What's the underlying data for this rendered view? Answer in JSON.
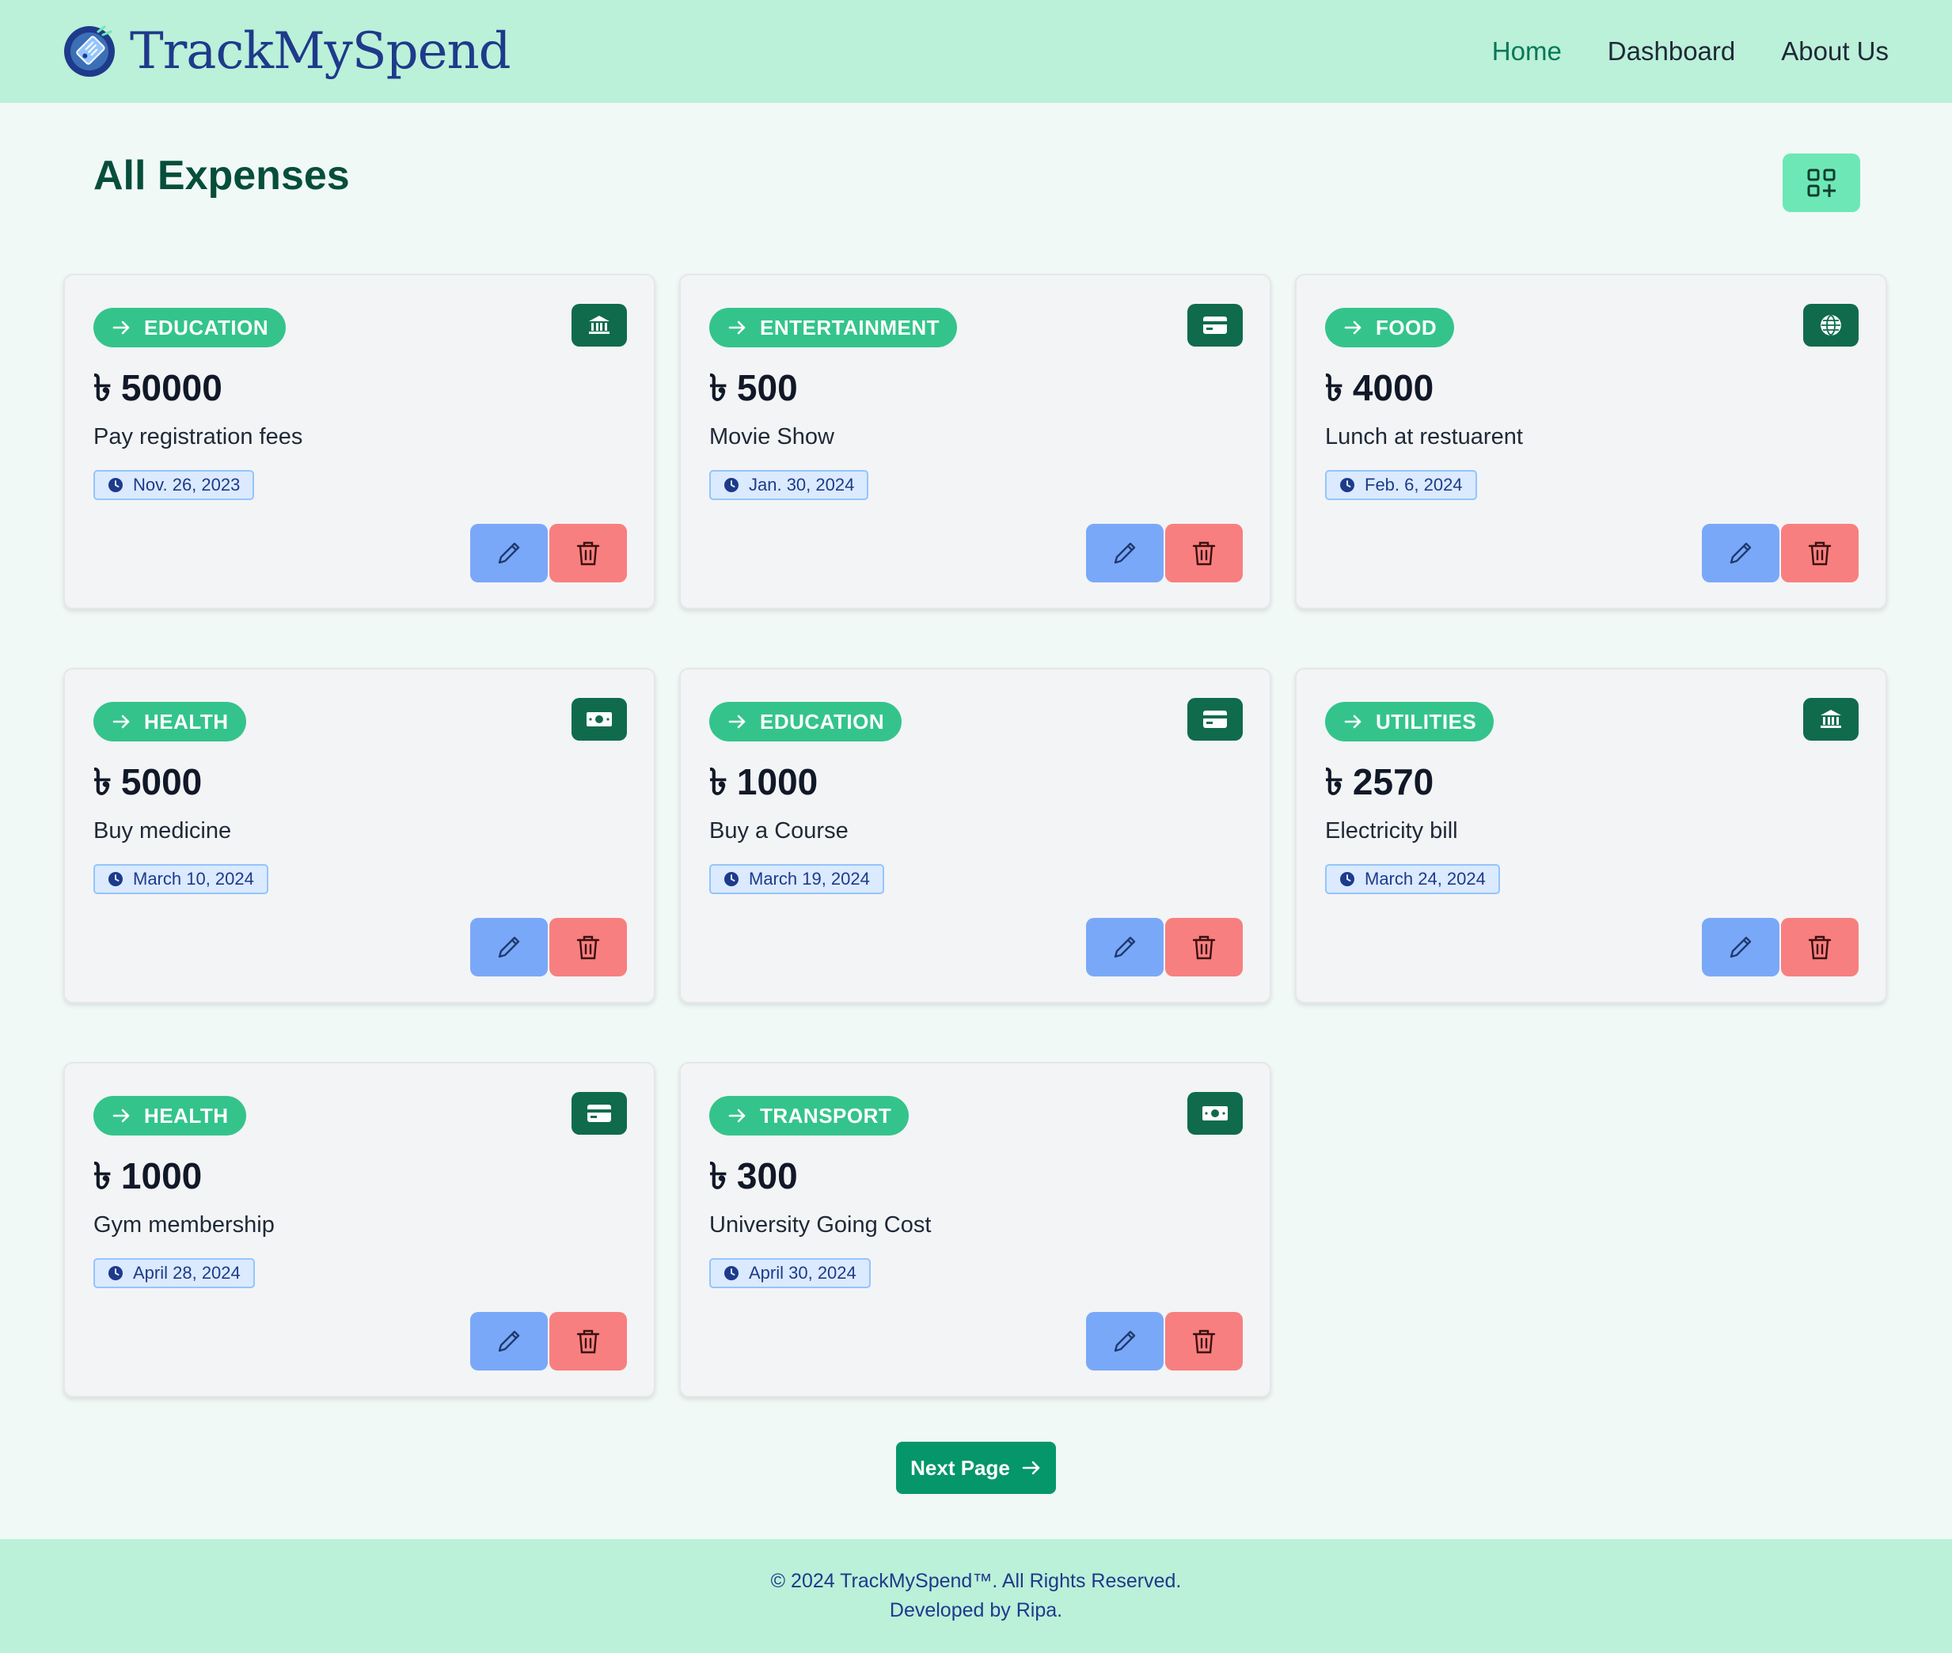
{
  "brand": {
    "name": "TrackMySpend"
  },
  "nav": {
    "items": [
      {
        "label": "Home",
        "active": true
      },
      {
        "label": "Dashboard",
        "active": false
      },
      {
        "label": "About Us",
        "active": false
      }
    ]
  },
  "page": {
    "title": "All Expenses"
  },
  "currency_symbol": "৳",
  "expenses": [
    {
      "category": "EDUCATION",
      "amount": "50000",
      "description": "Pay registration fees",
      "date": "Nov. 26, 2023",
      "method_icon": "bank-icon"
    },
    {
      "category": "ENTERTAINMENT",
      "amount": "500",
      "description": "Movie Show",
      "date": "Jan. 30, 2024",
      "method_icon": "credit-card-icon"
    },
    {
      "category": "FOOD",
      "amount": "4000",
      "description": "Lunch at restuarent",
      "date": "Feb. 6, 2024",
      "method_icon": "globe-icon"
    },
    {
      "category": "HEALTH",
      "amount": "5000",
      "description": "Buy medicine",
      "date": "March 10, 2024",
      "method_icon": "cash-icon"
    },
    {
      "category": "EDUCATION",
      "amount": "1000",
      "description": "Buy a Course",
      "date": "March 19, 2024",
      "method_icon": "credit-card-icon"
    },
    {
      "category": "UTILITIES",
      "amount": "2570",
      "description": "Electricity bill",
      "date": "March 24, 2024",
      "method_icon": "bank-icon"
    },
    {
      "category": "HEALTH",
      "amount": "1000",
      "description": "Gym membership",
      "date": "April 28, 2024",
      "method_icon": "credit-card-icon"
    },
    {
      "category": "TRANSPORT",
      "amount": "300",
      "description": "University Going Cost",
      "date": "April 30, 2024",
      "method_icon": "cash-icon"
    }
  ],
  "pagination": {
    "next_label": "Next Page"
  },
  "footer": {
    "line1": "© 2024 TrackMySpend™. All Rights Reserved.",
    "line2": "Developed by Ripa."
  },
  "colors": {
    "navbar_bg": "#bbf0d9",
    "page_bg": "#f0f9f5",
    "category_pill": "#34c48b",
    "method_icon_bg": "#0f6b4c",
    "edit_button": "#7aa8f8",
    "delete_button": "#f87f7f",
    "next_button": "#059669"
  }
}
